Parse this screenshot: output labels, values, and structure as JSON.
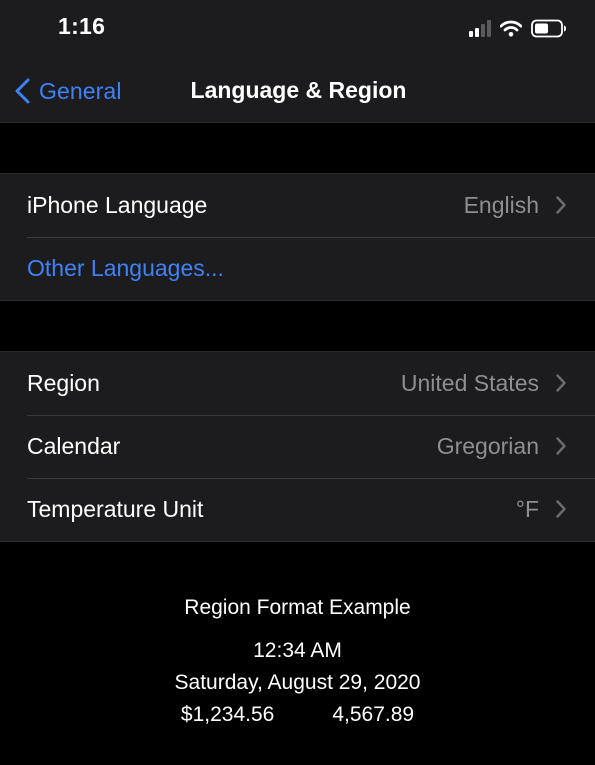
{
  "status_bar": {
    "time": "1:16"
  },
  "nav": {
    "back_label": "General",
    "title": "Language & Region"
  },
  "language_group": {
    "rows": [
      {
        "label": "iPhone Language",
        "value": "English"
      },
      {
        "label": "Other Languages..."
      }
    ]
  },
  "region_group": {
    "rows": [
      {
        "label": "Region",
        "value": "United States"
      },
      {
        "label": "Calendar",
        "value": "Gregorian"
      },
      {
        "label": "Temperature Unit",
        "value": "°F"
      }
    ]
  },
  "region_format_example": {
    "title": "Region Format Example",
    "time": "12:34 AM",
    "date": "Saturday, August 29, 2020",
    "currency": "$1,234.56",
    "number": "4,567.89"
  },
  "colors": {
    "background": "#000000",
    "cell": "#1c1c1e",
    "accent": "#3f82f6",
    "secondary_text": "#8e8e93"
  },
  "icons": [
    "cellular-signal-icon",
    "wifi-icon",
    "battery-icon",
    "chevron-left-icon",
    "chevron-right-icon"
  ]
}
